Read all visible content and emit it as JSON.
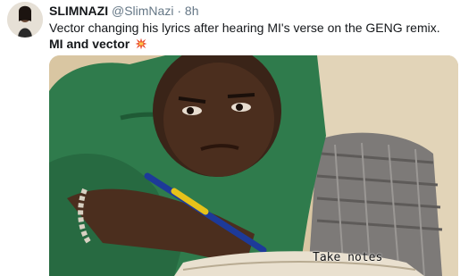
{
  "tweet": {
    "display_name": "SLIMNAZI",
    "handle": "@SlimNazi",
    "separator": "·",
    "time": "8h",
    "text_line1": "Vector changing his lyrics after hearing MI's verse on the GENG remix.",
    "text_line2": "MI and vector",
    "emoji": "collision-icon"
  },
  "media": {
    "caption": "Take notes"
  }
}
